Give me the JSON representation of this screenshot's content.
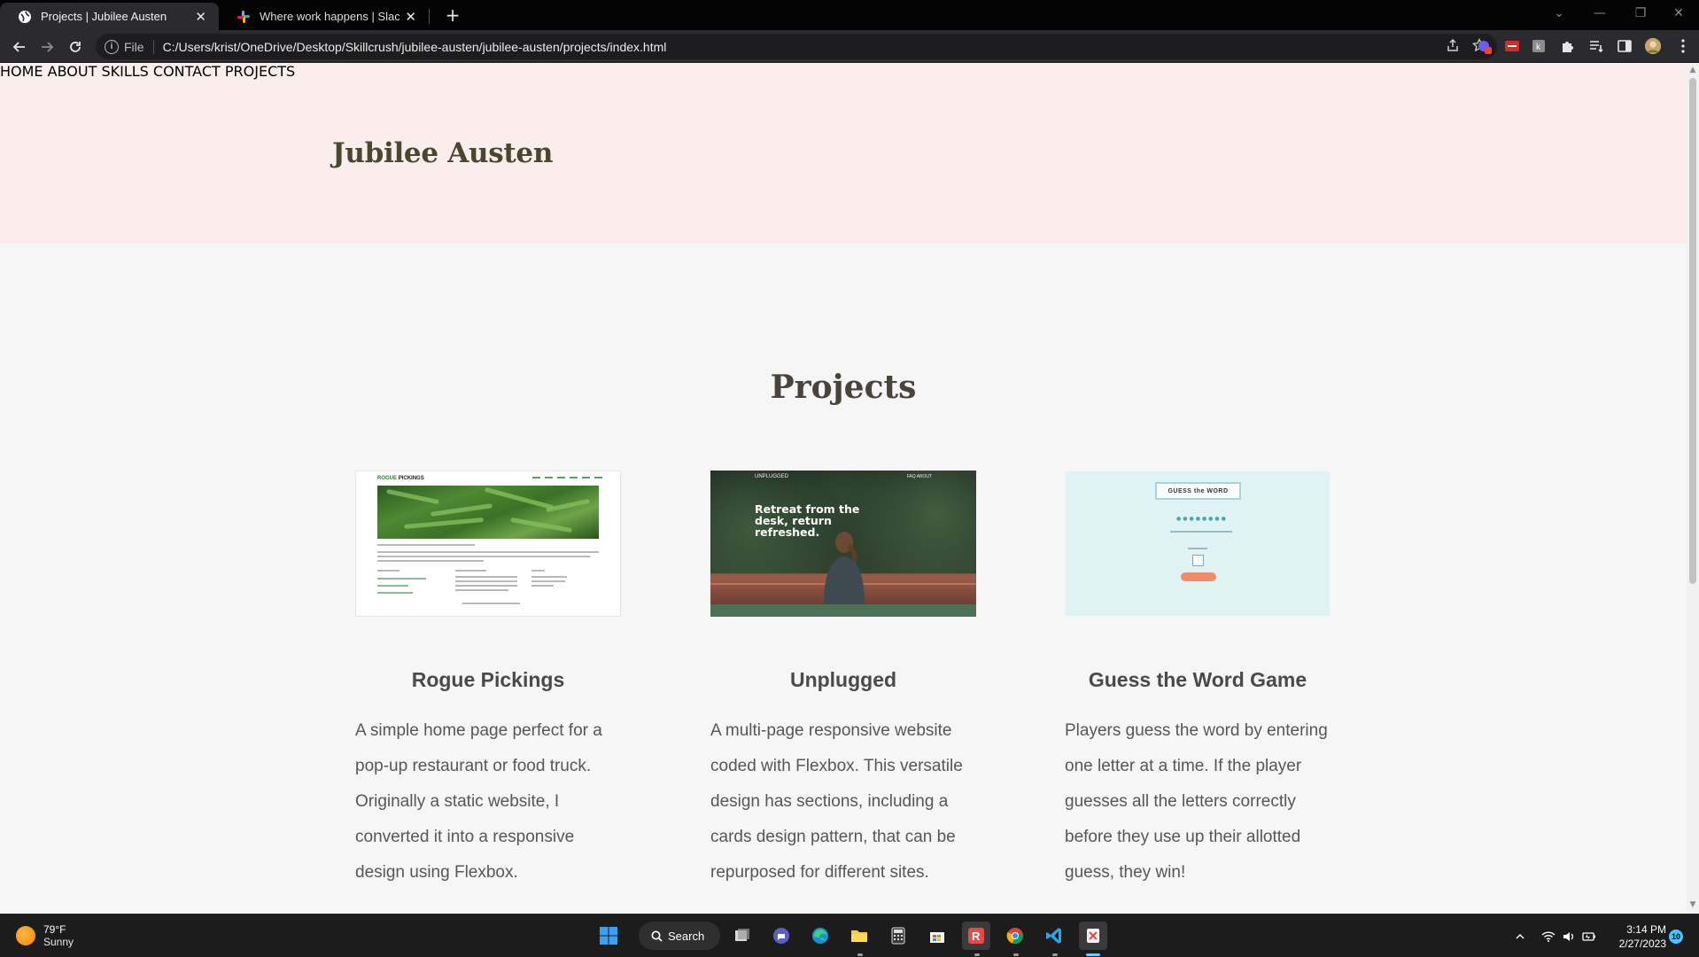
{
  "browser": {
    "tabs": [
      {
        "title": "Projects | Jubilee Austen",
        "active": true
      },
      {
        "title": "Where work happens | Slack",
        "active": false
      }
    ],
    "omnibox": {
      "scheme": "File",
      "url": "C:/Users/krist/OneDrive/Desktop/Skillcrush/jubilee-austen/jubilee-austen/projects/index.html"
    }
  },
  "site": {
    "logo": "Jubilee Austen",
    "nav": [
      "HOME",
      "ABOUT",
      "SKILLS",
      "CONTACT",
      "PROJECTS"
    ],
    "section_title": "Projects",
    "projects": [
      {
        "title": "Rogue Pickings",
        "description": "A simple home page perfect for a pop-up restaurant or food truck. Originally a static website, I converted it into a responsive design using Flexbox.",
        "thumb_brand_a": "ROGUE",
        "thumb_brand_b": "PICKINGS"
      },
      {
        "title": "Unplugged",
        "description": "A multi-page responsive website coded with Flexbox. This versatile design has sections, including a cards design pattern, that can be repurposed for different sites.",
        "thumb_logo": "UNPLUGGED",
        "thumb_links": "FAQ     ABOUT",
        "thumb_hero": "Retreat from the desk, return refreshed."
      },
      {
        "title": "Guess the Word Game",
        "description": "Players guess the word by entering one letter at a time. If the player guesses all the letters correctly before they use up their allotted guess, they win!",
        "thumb_banner": "GUESS the WORD",
        "thumb_dots": "●●●●●●●●"
      }
    ]
  },
  "taskbar": {
    "weather_temp": "79°F",
    "weather_desc": "Sunny",
    "search_label": "Search",
    "time": "3:14 PM",
    "date": "2/27/2023",
    "notification_count": "10"
  },
  "colors": {
    "header_bg": "#faeeec",
    "page_bg": "#f6f6f6",
    "logo": "#4a4730",
    "nav_link": "#4d4935",
    "accent_taskbar": "#60cdff"
  }
}
